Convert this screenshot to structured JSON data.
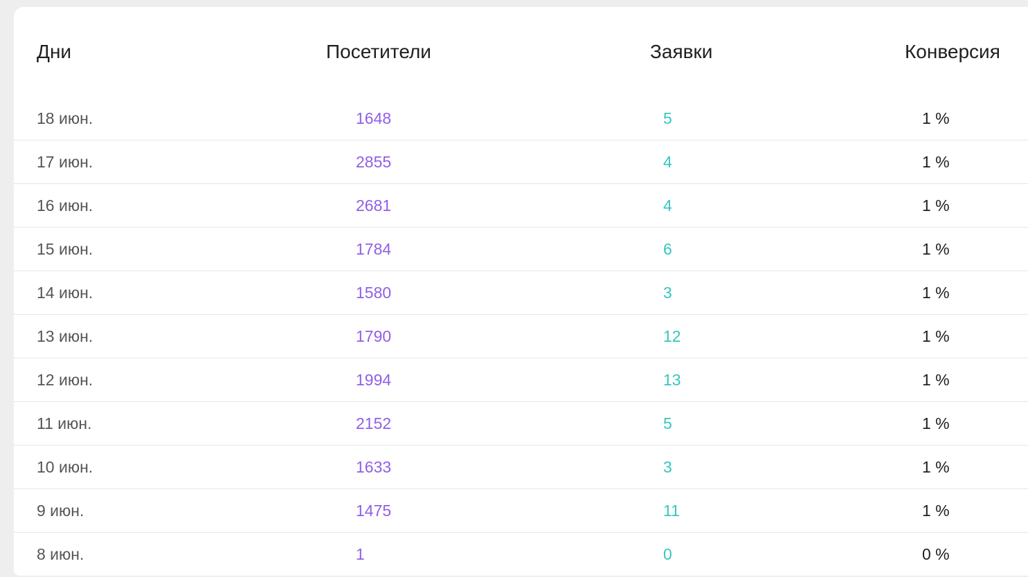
{
  "table": {
    "headers": {
      "day": "Дни",
      "visitors": "Посетители",
      "requests": "Заявки",
      "conversion": "Конверсия"
    },
    "colors": {
      "visitors": "#8f5fe8",
      "requests": "#36c6c0",
      "day": "#555555",
      "conversion": "#1f1f1f"
    },
    "rows": [
      {
        "day": "18 июн.",
        "visitors": "1648",
        "requests": "5",
        "conversion": "1 %"
      },
      {
        "day": "17 июн.",
        "visitors": "2855",
        "requests": "4",
        "conversion": "1 %"
      },
      {
        "day": "16 июн.",
        "visitors": "2681",
        "requests": "4",
        "conversion": "1 %"
      },
      {
        "day": "15 июн.",
        "visitors": "1784",
        "requests": "6",
        "conversion": "1 %"
      },
      {
        "day": "14 июн.",
        "visitors": "1580",
        "requests": "3",
        "conversion": "1 %"
      },
      {
        "day": "13 июн.",
        "visitors": "1790",
        "requests": "12",
        "conversion": "1 %"
      },
      {
        "day": "12 июн.",
        "visitors": "1994",
        "requests": "13",
        "conversion": "1 %"
      },
      {
        "day": "11 июн.",
        "visitors": "2152",
        "requests": "5",
        "conversion": "1 %"
      },
      {
        "day": "10 июн.",
        "visitors": "1633",
        "requests": "3",
        "conversion": "1 %"
      },
      {
        "day": "9 июн.",
        "visitors": "1475",
        "requests": "11",
        "conversion": "1 %"
      },
      {
        "day": "8 июн.",
        "visitors": "1",
        "requests": "0",
        "conversion": "0 %"
      }
    ]
  }
}
